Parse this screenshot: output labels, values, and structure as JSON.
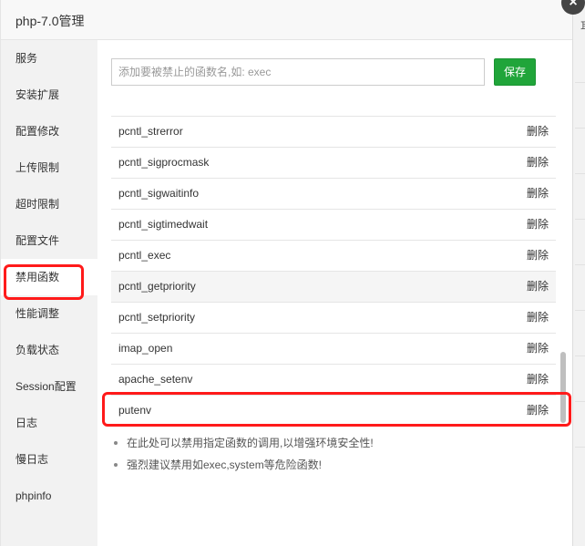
{
  "window": {
    "title": "php-7.0管理"
  },
  "sidebar": {
    "items": [
      {
        "label": "服务"
      },
      {
        "label": "安装扩展"
      },
      {
        "label": "配置修改"
      },
      {
        "label": "上传限制"
      },
      {
        "label": "超时限制"
      },
      {
        "label": "配置文件"
      },
      {
        "label": "禁用函数",
        "active": true
      },
      {
        "label": "性能调整"
      },
      {
        "label": "负载状态"
      },
      {
        "label": "Session配置"
      },
      {
        "label": "日志"
      },
      {
        "label": "慢日志"
      },
      {
        "label": "phpinfo"
      }
    ]
  },
  "form": {
    "placeholder": "添加要被禁止的函数名,如: exec",
    "value": "",
    "save_label": "保存"
  },
  "functions": {
    "action_label": "删除",
    "rows": [
      {
        "name": "pcntl_strerror"
      },
      {
        "name": "pcntl_sigprocmask"
      },
      {
        "name": "pcntl_sigwaitinfo"
      },
      {
        "name": "pcntl_sigtimedwait"
      },
      {
        "name": "pcntl_exec"
      },
      {
        "name": "pcntl_getpriority",
        "hovered": true
      },
      {
        "name": "pcntl_setpriority"
      },
      {
        "name": "imap_open"
      },
      {
        "name": "apache_setenv"
      },
      {
        "name": "putenv",
        "highlighted": true
      }
    ]
  },
  "tips": [
    "在此处可以禁用指定函数的调用,以增强环境安全性!",
    "强烈建议禁用如exec,system等危险函数!"
  ],
  "colors": {
    "accent": "#20a53a",
    "highlight": "#ff1a1a",
    "sidebar_bg": "#f2f2f2"
  }
}
